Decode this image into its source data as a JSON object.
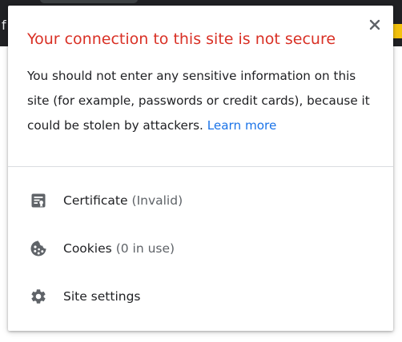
{
  "background": {
    "ghost_letter": "f"
  },
  "popup": {
    "title": "Your connection to this site is not secure",
    "message": "You should not enter any sensitive information on this site (for example, passwords or credit cards), because it could be stolen by attackers.",
    "learn_more": "Learn more",
    "close_icon": "close-icon",
    "rows": [
      {
        "icon": "certificate-icon",
        "label": "Certificate",
        "detail": "(Invalid)"
      },
      {
        "icon": "cookie-icon",
        "label": "Cookies",
        "detail": "(0 in use)"
      },
      {
        "icon": "gear-icon",
        "label": "Site settings"
      }
    ]
  },
  "colors": {
    "title_red": "#d93025",
    "link_blue": "#1a73e8",
    "text": "#202124",
    "secondary_text": "#5f6368",
    "icon_gray": "#5f6368",
    "divider": "#dadce0",
    "topbar": "#202124"
  }
}
